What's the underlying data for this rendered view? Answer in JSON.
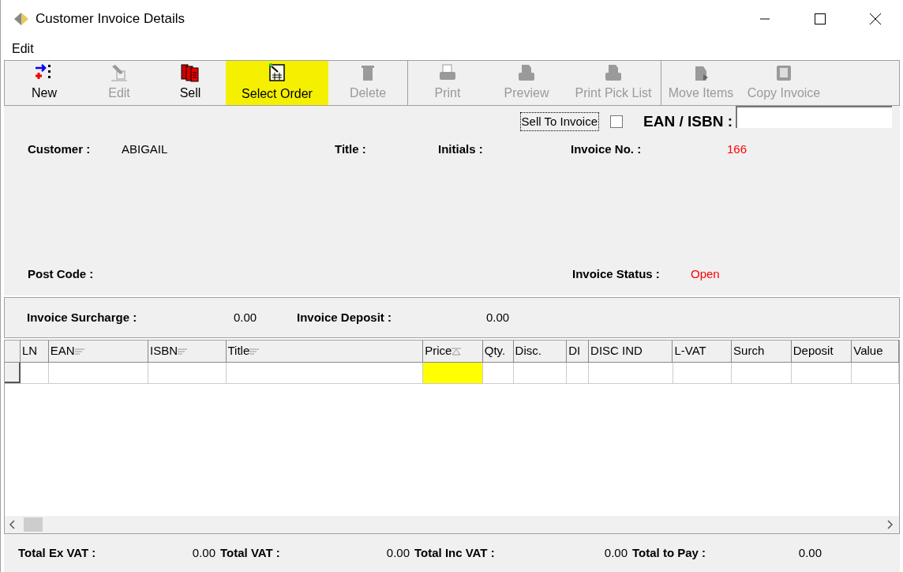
{
  "window": {
    "title": "Customer Invoice Details"
  },
  "menu": [
    "Edit"
  ],
  "toolbar": {
    "groups": [
      {
        "buttons": [
          {
            "label": "New",
            "disabled": false,
            "highlighted": false
          },
          {
            "label": "Edit",
            "disabled": true,
            "highlighted": false
          },
          {
            "label": "Sell",
            "disabled": false,
            "highlighted": false
          },
          {
            "label": "Select Order",
            "disabled": false,
            "highlighted": true
          },
          {
            "label": "Delete",
            "disabled": true,
            "highlighted": false
          }
        ]
      },
      {
        "buttons": [
          {
            "label": "Print",
            "disabled": true,
            "highlighted": false
          },
          {
            "label": "Preview",
            "disabled": true,
            "highlighted": false
          },
          {
            "label": "Print Pick List",
            "disabled": true,
            "highlighted": false
          }
        ]
      },
      {
        "buttons": [
          {
            "label": "Move Items",
            "disabled": true,
            "highlighted": false
          },
          {
            "label": "Copy Invoice",
            "disabled": true,
            "highlighted": false
          }
        ]
      }
    ]
  },
  "sell_to_invoice": {
    "label": "Sell To Invoice",
    "checked": false
  },
  "ean_isbn": {
    "label": "EAN / ISBN :"
  },
  "details": {
    "customer_label": "Customer :",
    "customer": "ABIGAIL",
    "title_label": "Title :",
    "initials_label": "Initials :",
    "invoice_no_label": "Invoice No. :",
    "invoice_no": "166",
    "post_code_label": "Post Code :",
    "status_label": "Invoice Status :",
    "status": "Open"
  },
  "surcharge": {
    "surcharge_label": "Invoice Surcharge :",
    "surcharge": "0.00",
    "deposit_label": "Invoice Deposit :",
    "deposit": "0.00"
  },
  "table": {
    "columns": [
      {
        "label": "LN",
        "kind": "plain",
        "highlighted": false
      },
      {
        "label": "EAN",
        "kind": "filter",
        "highlighted": false
      },
      {
        "label": "ISBN",
        "kind": "filter",
        "highlighted": false
      },
      {
        "label": "Title",
        "kind": "filter",
        "highlighted": false
      },
      {
        "label": "Price",
        "kind": "sort",
        "highlighted": true
      },
      {
        "label": "Qty.",
        "kind": "plain",
        "highlighted": false
      },
      {
        "label": "Disc.",
        "kind": "plain",
        "highlighted": false
      },
      {
        "label": "DI",
        "kind": "plain",
        "highlighted": false
      },
      {
        "label": "DISC IND",
        "kind": "plain",
        "highlighted": false
      },
      {
        "label": "L-VAT",
        "kind": "plain",
        "highlighted": false
      },
      {
        "label": "Surch",
        "kind": "plain",
        "highlighted": false
      },
      {
        "label": "Deposit",
        "kind": "plain",
        "highlighted": false
      },
      {
        "label": "Value",
        "kind": "plain",
        "highlighted": false
      }
    ]
  },
  "totals": [
    {
      "label": "Total Ex VAT :",
      "value": "0.00"
    },
    {
      "label": "Total VAT :",
      "value": "0.00"
    },
    {
      "label": "Total Inc VAT :",
      "value": "0.00"
    },
    {
      "label": "Total to Pay :",
      "value": "0.00"
    }
  ]
}
